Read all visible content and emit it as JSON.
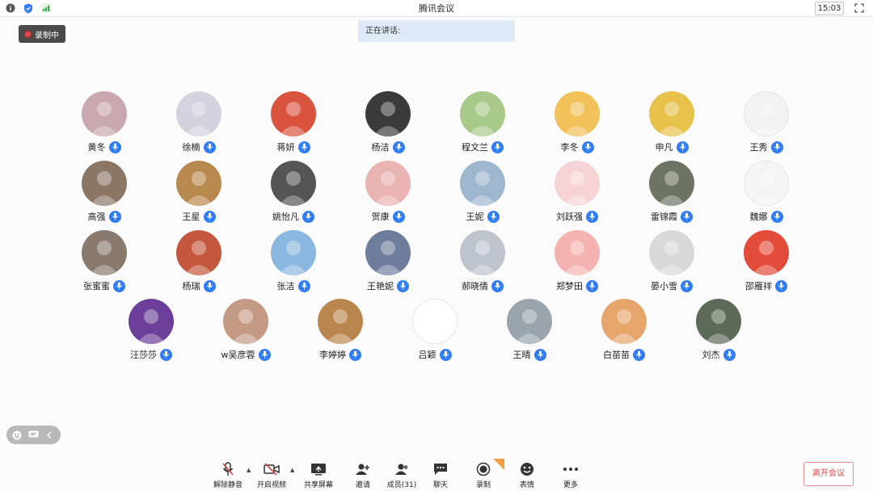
{
  "window": {
    "title": "腾讯会议",
    "clock": "15:03",
    "icons": [
      "info-icon",
      "shield-icon",
      "signal-icon",
      "fullscreen-icon"
    ]
  },
  "recording_badge": {
    "label": "录制中"
  },
  "speaking_bar": {
    "label": "正在讲话:"
  },
  "participants": [
    {
      "name": "黄冬",
      "color": "#c9a7b0"
    },
    {
      "name": "徐楠",
      "color": "#d4d2dc"
    },
    {
      "name": "蒋妍",
      "color": "#d9533f"
    },
    {
      "name": "杨洁",
      "color": "#3b3b3b"
    },
    {
      "name": "程文兰",
      "color": "#a9c98b"
    },
    {
      "name": "李冬",
      "color": "#f2c15a"
    },
    {
      "name": "申凡",
      "color": "#e7c24a"
    },
    {
      "name": "王秀",
      "color": "#f2f2f2"
    },
    {
      "name": "高强",
      "color": "#8c7766"
    },
    {
      "name": "王星",
      "color": "#b8894f"
    },
    {
      "name": "姚怡凡",
      "color": "#555555"
    },
    {
      "name": "贺康",
      "color": "#e9b3b1"
    },
    {
      "name": "王妮",
      "color": "#9fb6cf"
    },
    {
      "name": "刘跃强",
      "color": "#f6d4d6"
    },
    {
      "name": "雷锦霞",
      "color": "#6e7463"
    },
    {
      "name": "魏娜",
      "color": "#f5f5f5"
    },
    {
      "name": "张蜜蜜",
      "color": "#8a7a6e"
    },
    {
      "name": "杨瑞",
      "color": "#c4573d"
    },
    {
      "name": "张洁",
      "color": "#8ab7e0"
    },
    {
      "name": "王艳妮",
      "color": "#6f7d9c"
    },
    {
      "name": "郝晓倩",
      "color": "#bfc4cc"
    },
    {
      "name": "郑梦田",
      "color": "#f4b3b0"
    },
    {
      "name": "晏小雪",
      "color": "#d9d9d9"
    },
    {
      "name": "邵雁祥",
      "color": "#e34b3a"
    },
    {
      "name": "汪莎莎",
      "color": "#6b3f9a"
    },
    {
      "name": "w吴彦蓉",
      "color": "#c59a84"
    },
    {
      "name": "李婷婷",
      "color": "#b9874e"
    },
    {
      "name": "吕颖",
      "color": "#ffffff"
    },
    {
      "name": "王晴",
      "color": "#9aa4ad"
    },
    {
      "name": "白苗苗",
      "color": "#e5a56b"
    },
    {
      "name": "刘杰",
      "color": "#5e6a58"
    }
  ],
  "toolbar": {
    "unmute": "解除静音",
    "video": "开启视频",
    "share": "共享屏幕",
    "invite": "邀请",
    "members": "成员(31)",
    "chat": "聊天",
    "record": "录制",
    "reactions": "表情",
    "more": "更多",
    "leave": "离开会议"
  }
}
